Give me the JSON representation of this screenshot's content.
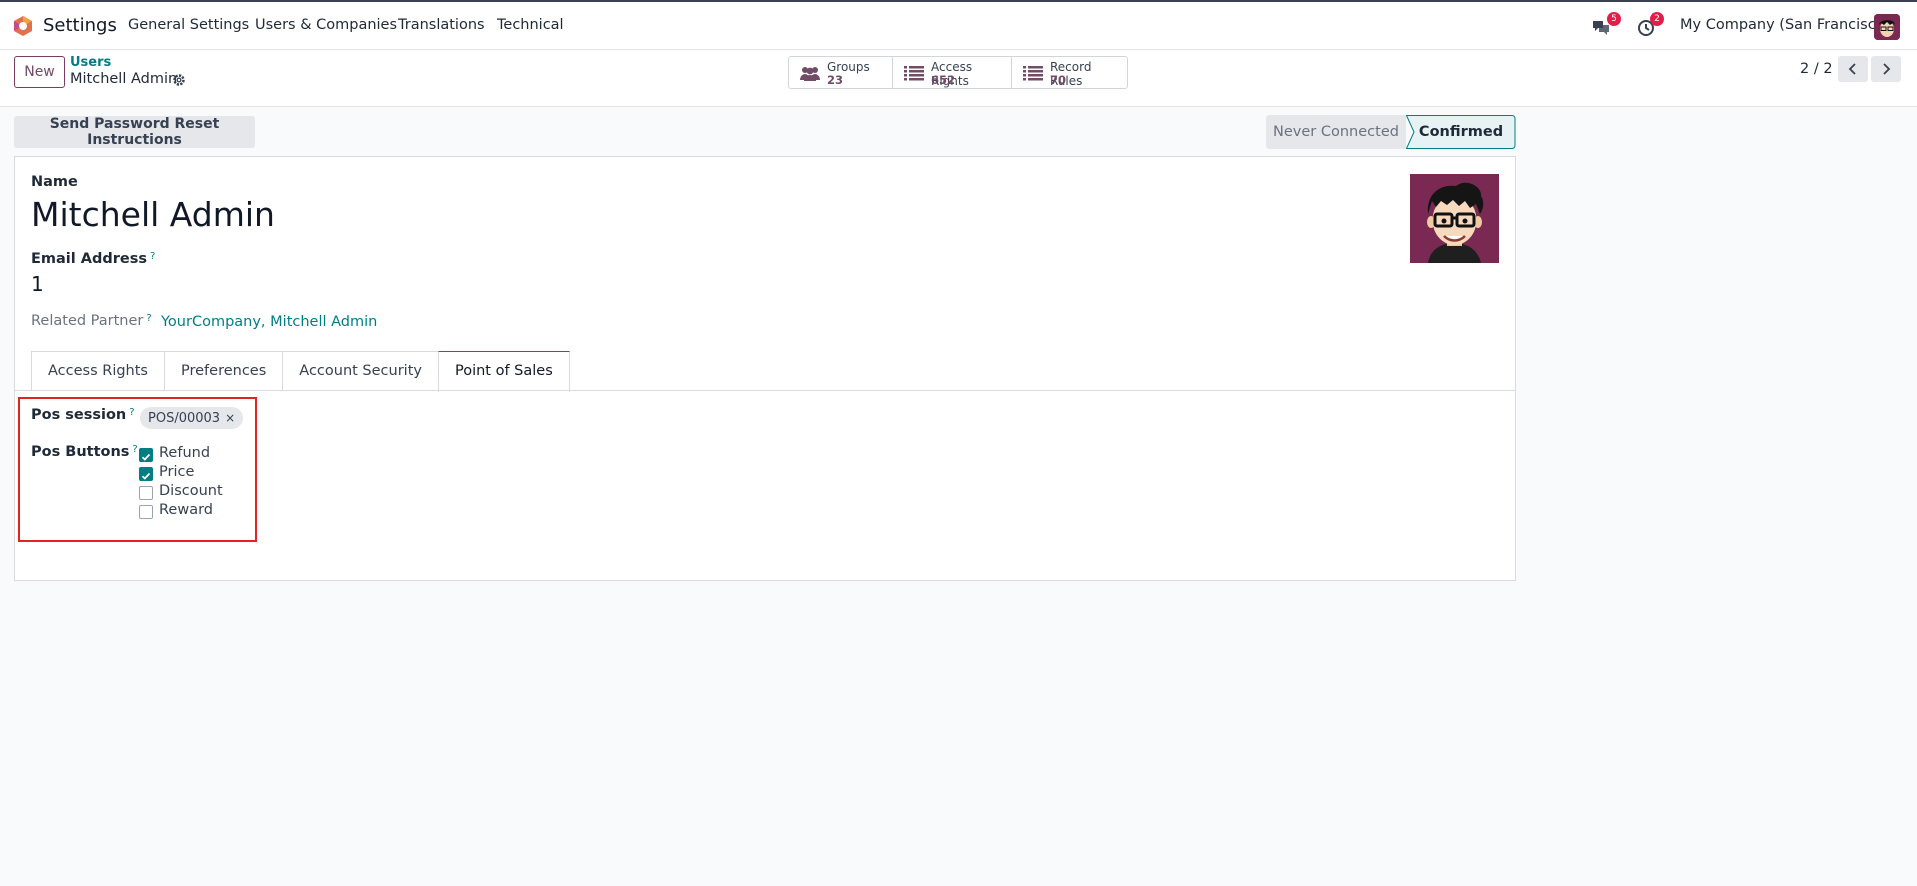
{
  "navbar": {
    "app_name": "Settings",
    "menu": [
      "General Settings",
      "Users & Companies",
      "Translations",
      "Technical"
    ],
    "messages_count": "5",
    "activities_count": "2",
    "company": "My Company (San Francisco)"
  },
  "control": {
    "new_label": "New",
    "breadcrumb_parent": "Users",
    "breadcrumb_current": "Mitchell Admin",
    "stats": [
      {
        "label": "Groups",
        "value": "23",
        "icon": "users-icon"
      },
      {
        "label": "Access Rights",
        "value": "652",
        "icon": "list-icon"
      },
      {
        "label": "Record Rules",
        "value": "70",
        "icon": "list-icon"
      }
    ],
    "pager": "2 / 2"
  },
  "header": {
    "reset_button": "Send Password Reset Instructions",
    "status_never": "Never Connected",
    "status_confirmed": "Confirmed"
  },
  "form": {
    "name_label": "Name",
    "name_value": "Mitchell Admin",
    "email_label": "Email Address",
    "email_value": "1",
    "partner_label": "Related Partner",
    "partner_value": "YourCompany, Mitchell Admin",
    "help_mark": "?"
  },
  "tabs": [
    "Access Rights",
    "Preferences",
    "Account Security",
    "Point of Sales"
  ],
  "pos": {
    "session_label": "Pos session",
    "session_tag": "POS/00003",
    "buttons_label": "Pos Buttons",
    "buttons": [
      {
        "label": "Refund",
        "checked": true
      },
      {
        "label": "Price",
        "checked": true
      },
      {
        "label": "Discount",
        "checked": false
      },
      {
        "label": "Reward",
        "checked": false
      }
    ]
  },
  "colors": {
    "brand": "#714b67",
    "teal": "#017e84",
    "highlight": "#e02424"
  }
}
